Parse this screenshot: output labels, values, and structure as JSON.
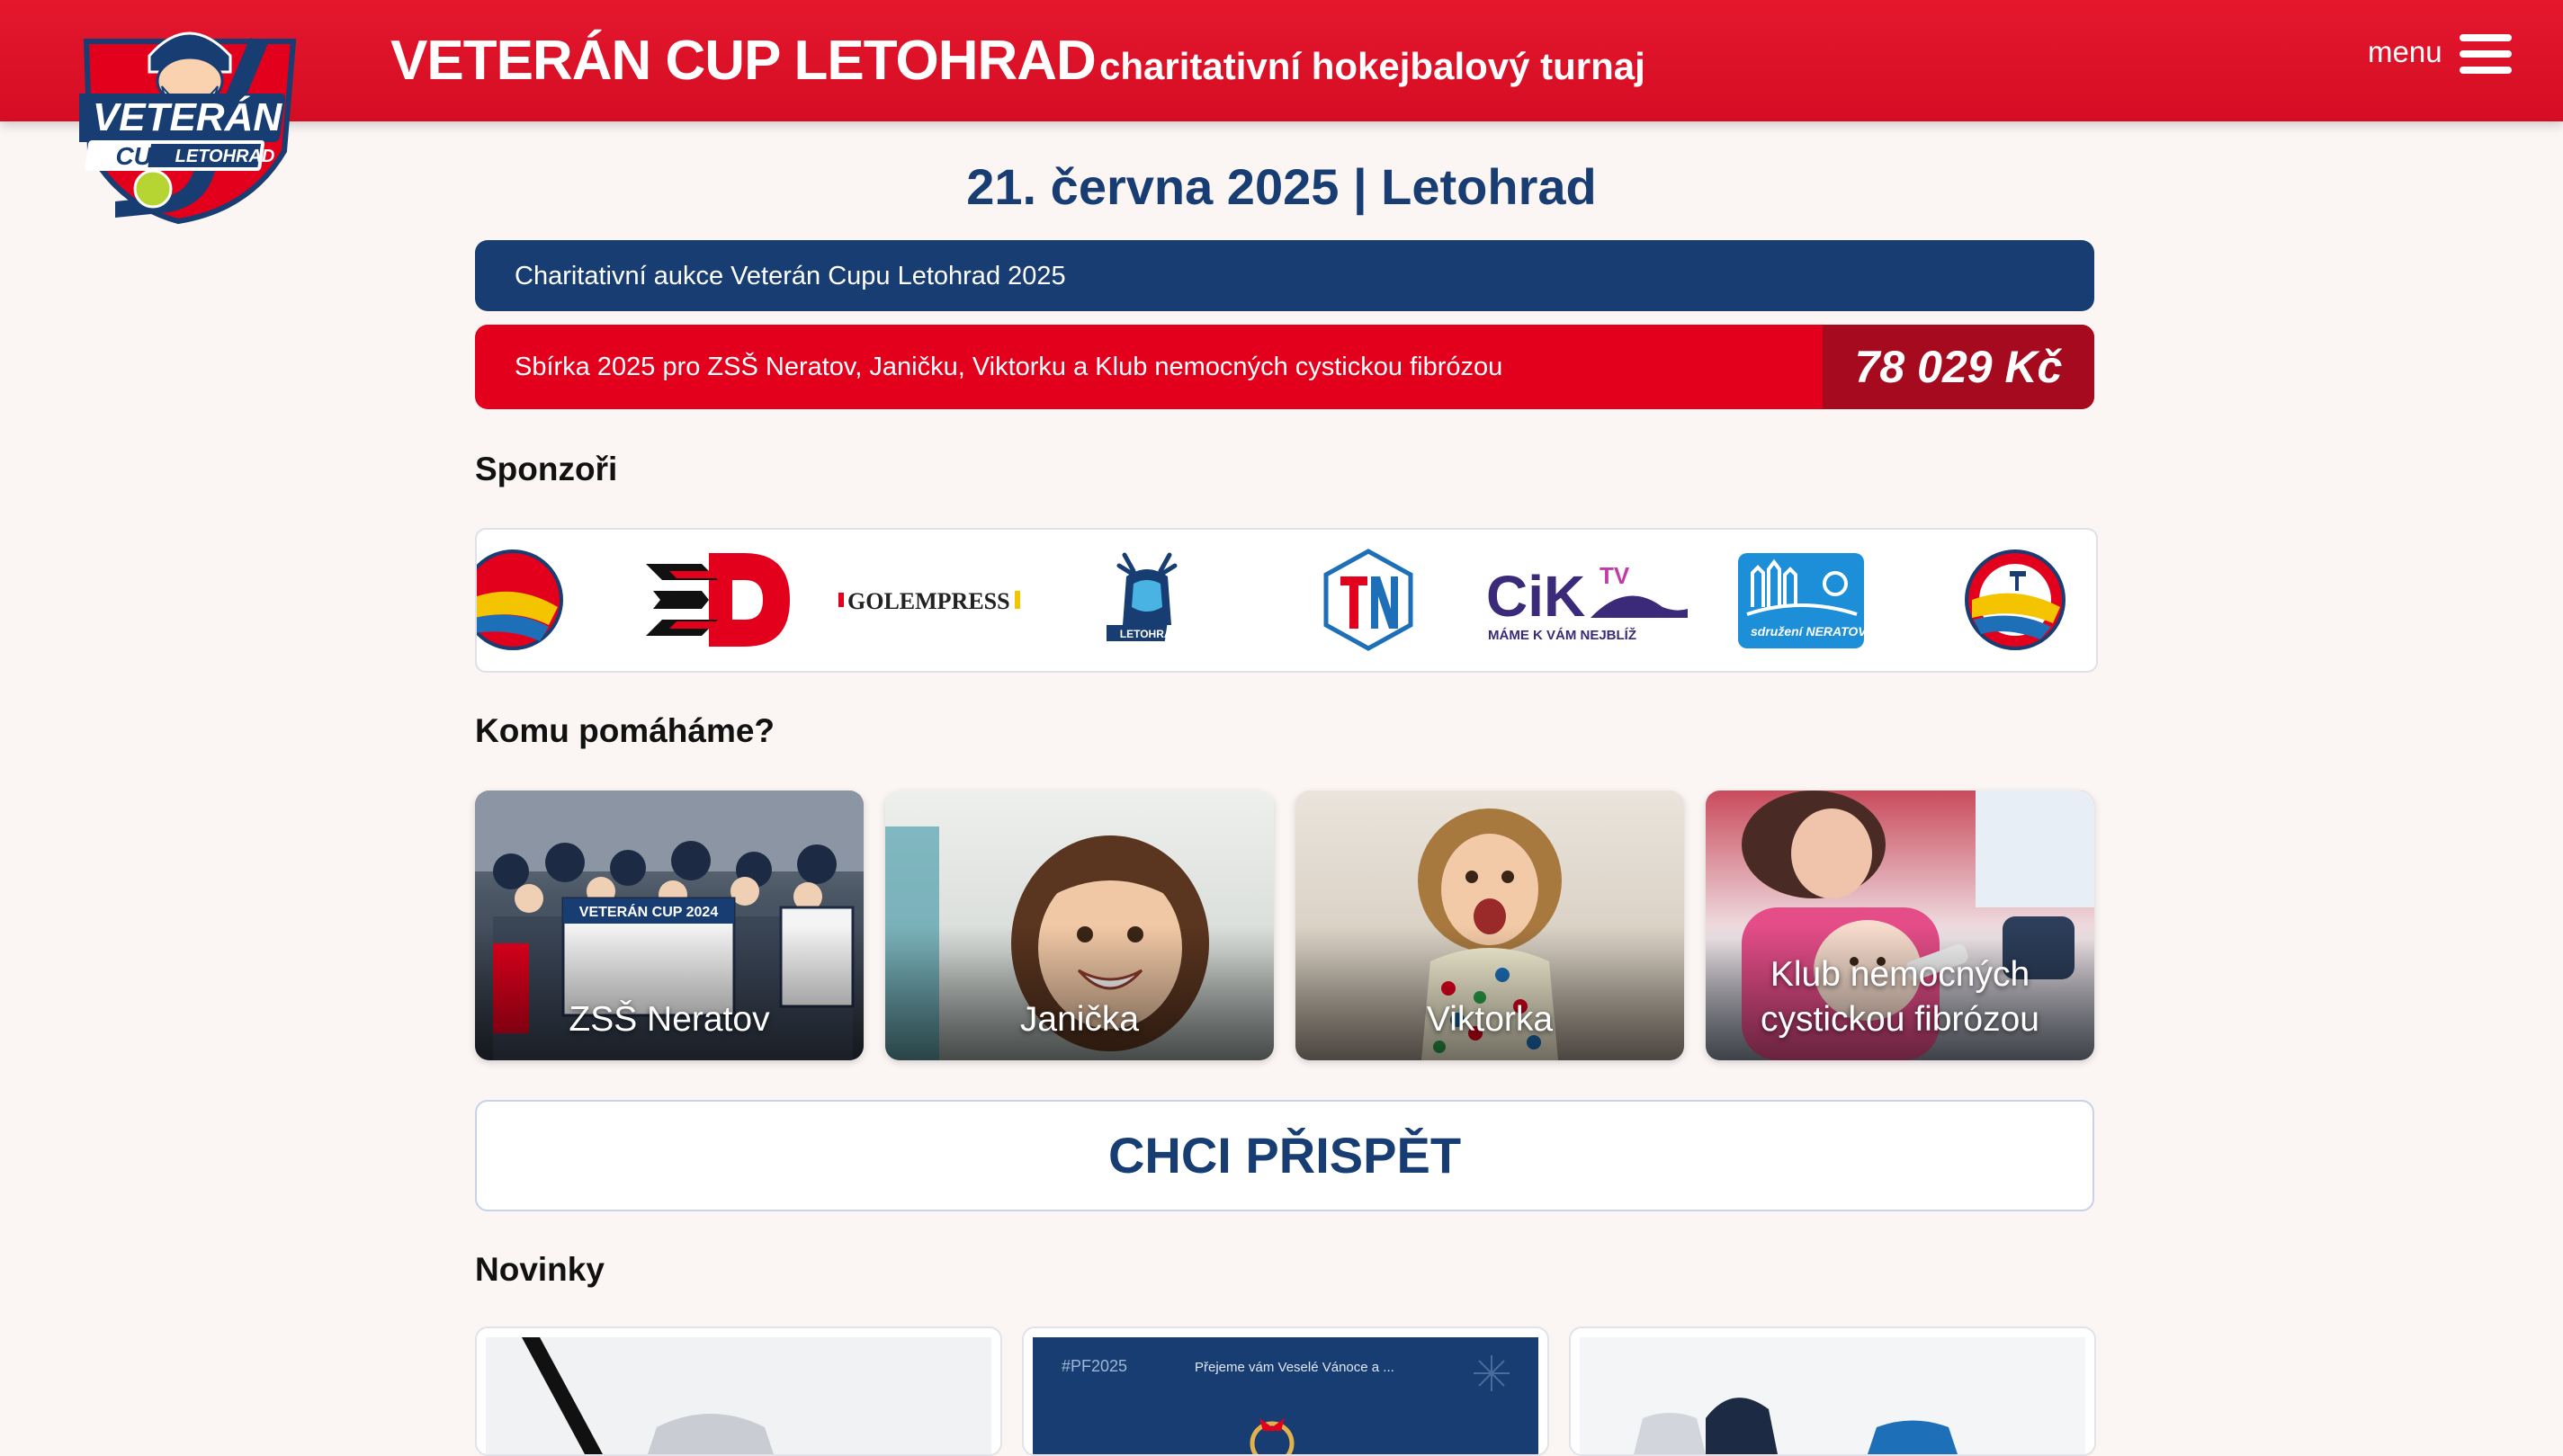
{
  "header": {
    "title": "VETERÁN CUP LETOHRAD",
    "subtitle": "charitativní hokejbalový turnaj",
    "menu_label": "menu",
    "logo_text": "VETERÁN CUP LETOHRAD"
  },
  "event": {
    "date_place": "21. června 2025 | Letohrad"
  },
  "auction": {
    "label": "Charitativní aukce Veterán Cupu Letohrad 2025"
  },
  "collection": {
    "label": "Sbírka 2025 pro ZSŠ Neratov, Janičku, Viktorku a Klub nemocných cystickou fibrózou",
    "amount": "78 029 Kč"
  },
  "sponsors": {
    "heading": "Sponzoři",
    "items": [
      {
        "name": "HC Vítkovice",
        "icon": "vitkovice-logo"
      },
      {
        "name": "Dynamo",
        "icon": "dynamo-logo",
        "text": "D"
      },
      {
        "name": "Golempress",
        "icon": "golempress-logo",
        "text": "GOLEMPRESS"
      },
      {
        "name": "Letohrad",
        "icon": "letohrad-logo",
        "text": "LETOHRAD"
      },
      {
        "name": "TN",
        "icon": "tn-logo",
        "text": "T|N"
      },
      {
        "name": "CIK TV",
        "icon": "ciktv-logo",
        "text": "CiK",
        "text2": "TV",
        "tagline": "MÁME K VÁM NEJBLÍŽ"
      },
      {
        "name": "Sdružení Neratov",
        "icon": "neratov-logo",
        "text": "sdružení NERATOV"
      },
      {
        "name": "HC Vítkovice",
        "icon": "vitkovice-logo"
      }
    ]
  },
  "beneficiaries": {
    "heading": "Komu pomáháme?",
    "items": [
      {
        "label": "ZSŠ Neratov",
        "banner": "VETERÁN CUP 2024"
      },
      {
        "label": "Janička"
      },
      {
        "label": "Viktorka"
      },
      {
        "label": "Klub nemocných cystickou fibrózou"
      }
    ]
  },
  "donate": {
    "label": "CHCI PŘISPĚT"
  },
  "news": {
    "heading": "Novinky",
    "items": [
      {
        "caption": ""
      },
      {
        "caption": "#PF2025",
        "text": "Přejeme vám Veselé Vánoce a ..."
      },
      {
        "caption": ""
      }
    ]
  },
  "colors": {
    "brand_red": "#e2001d",
    "brand_blue": "#173d72",
    "amount_bg": "#a50a1e",
    "page_bg": "#fbf5f3"
  }
}
